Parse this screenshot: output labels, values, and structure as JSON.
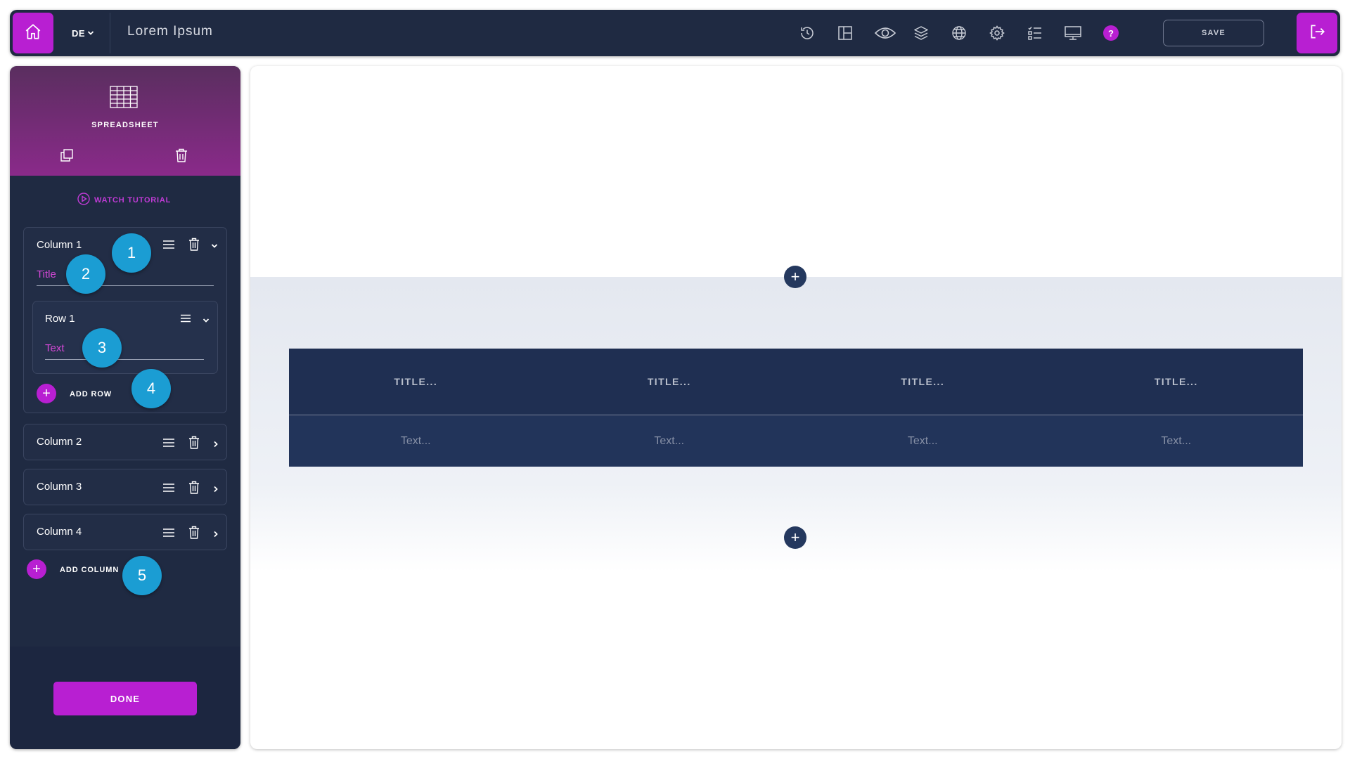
{
  "topbar": {
    "language": "DE",
    "title": "Lorem Ipsum",
    "help_label": "?",
    "save_label": "SAVE",
    "icons": [
      "home-icon",
      "chevron-down-icon",
      "history-icon",
      "layout-icon",
      "eye-icon",
      "layers-icon",
      "globe-icon",
      "gear-icon",
      "checklist-icon",
      "monitor-icon",
      "help-icon",
      "exit-icon"
    ]
  },
  "sidebar": {
    "header_title": "SPREADSHEET",
    "tutorial_label": "WATCH TUTORIAL",
    "column1": {
      "label": "Column 1",
      "title_value": "Title",
      "row1": {
        "label": "Row 1",
        "text_value": "Text"
      },
      "add_row_label": "ADD ROW"
    },
    "columns_collapsed": [
      {
        "label": "Column 2"
      },
      {
        "label": "Column 3"
      },
      {
        "label": "Column 4"
      }
    ],
    "add_column_label": "ADD COLUMN",
    "done_label": "DONE"
  },
  "badges": [
    "1",
    "2",
    "3",
    "4",
    "5"
  ],
  "canvas": {
    "add_section_label": "+",
    "table": {
      "headers": [
        "TITLE...",
        "TITLE...",
        "TITLE...",
        "TITLE..."
      ],
      "cells": [
        "Text...",
        "Text...",
        "Text...",
        "Text..."
      ]
    }
  },
  "colors": {
    "accent": "#b81fd2",
    "navy": "#1f2a42",
    "badge": "#1b9dd3",
    "table_bg": "#1f2f52"
  }
}
